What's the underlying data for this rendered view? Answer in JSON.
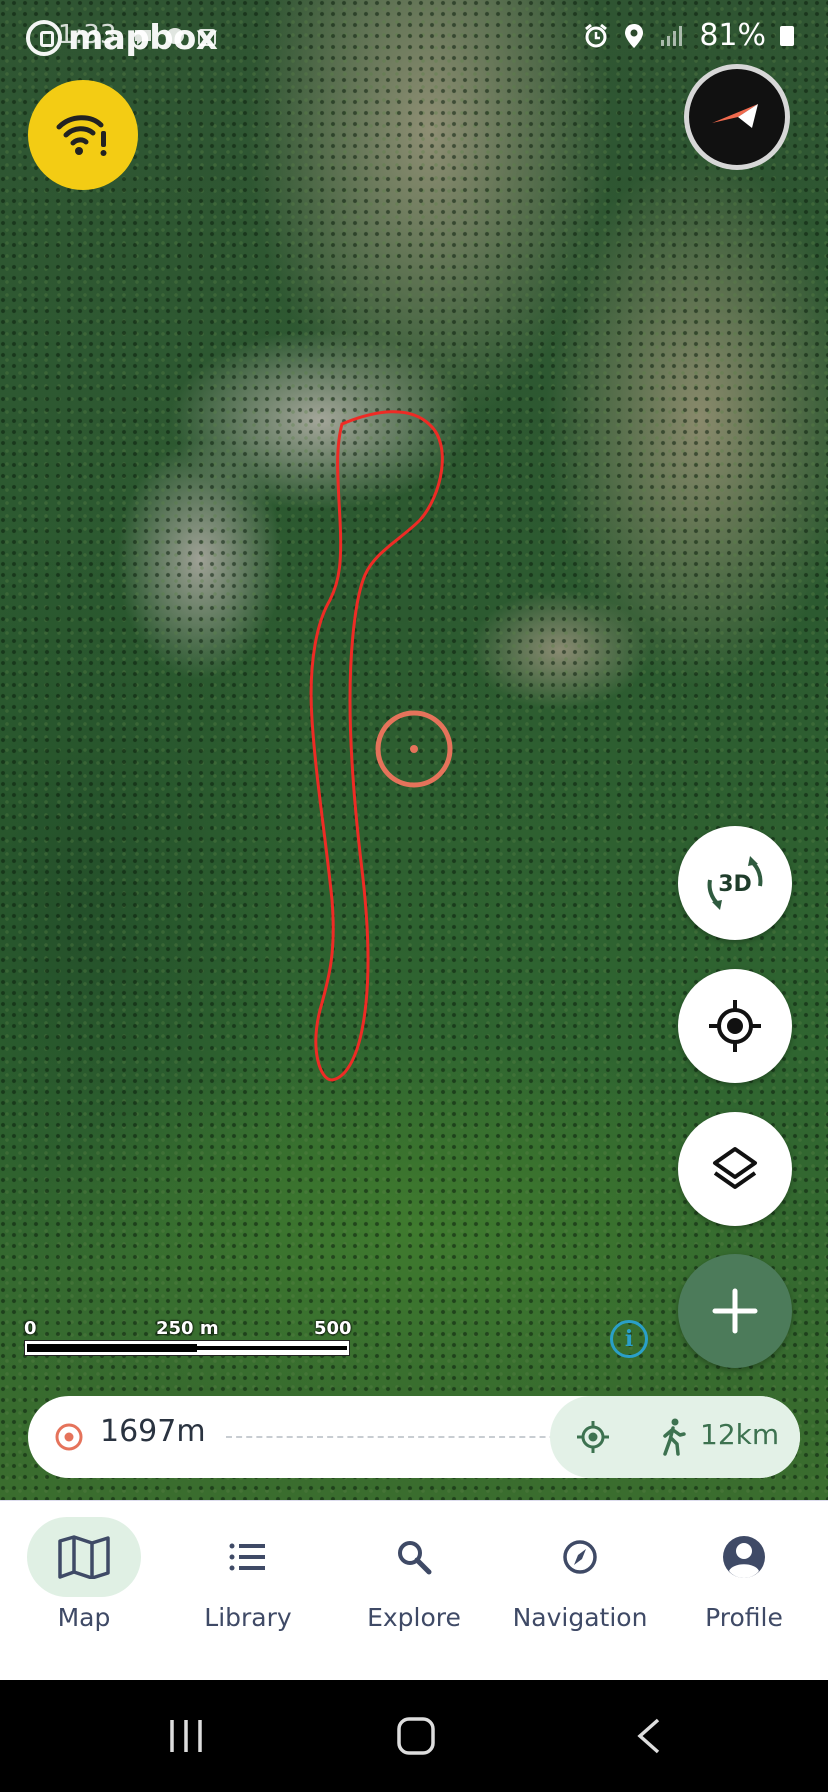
{
  "status_bar": {
    "time": "1:33",
    "battery": "81%"
  },
  "map_attribution": "mapbox",
  "scale": {
    "labels": [
      "0",
      "250 m",
      "500 m"
    ]
  },
  "map_controls": {
    "three_d_label": "3D"
  },
  "distance_bar": {
    "distance": "1697m",
    "walk_distance": "12km"
  },
  "nav": {
    "items": [
      {
        "label": "Map",
        "icon": "map-icon",
        "active": true
      },
      {
        "label": "Library",
        "icon": "list-icon",
        "active": false
      },
      {
        "label": "Explore",
        "icon": "search-icon",
        "active": false
      },
      {
        "label": "Navigation",
        "icon": "compass-icon",
        "active": false
      },
      {
        "label": "Profile",
        "icon": "profile-icon",
        "active": false
      }
    ]
  },
  "colors": {
    "offline_button": "#f3cc14",
    "add_button": "#4c7b5a",
    "route_line": "#ee2b25",
    "marker": "#e5735b",
    "active_tab_bg": "#e0f0e4",
    "accent_green": "#3d7250"
  }
}
